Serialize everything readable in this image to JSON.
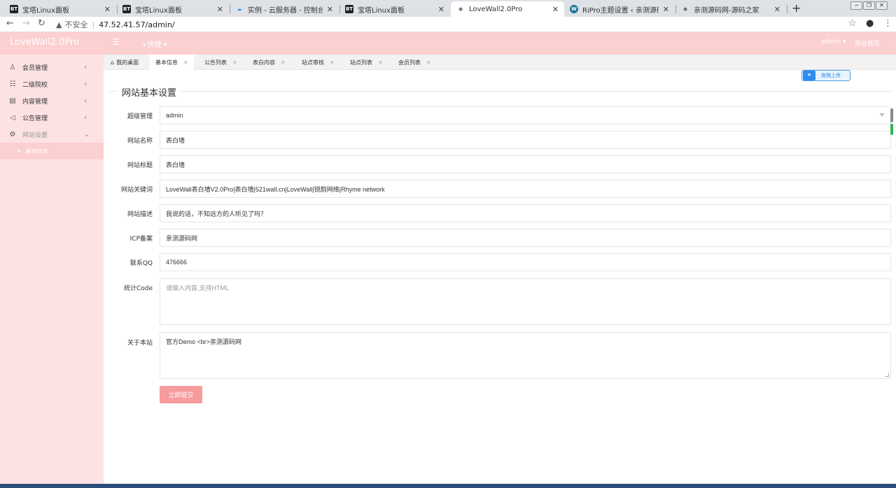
{
  "browser": {
    "tabs": [
      {
        "title": "宝塔Linux面板",
        "icon": "bt-icon"
      },
      {
        "title": "宝塔Linux面板",
        "icon": "bt-icon"
      },
      {
        "title": "实例 - 云服务器 - 控制台",
        "icon": "cloud-icon"
      },
      {
        "title": "宝塔Linux面板",
        "icon": "bt-icon"
      },
      {
        "title": "LoveWall2.0Pro",
        "icon": "globe-icon"
      },
      {
        "title": "RiPro主题设置 ‹ 亲测源码网 — V",
        "icon": "wordpress-icon"
      },
      {
        "title": "亲测源码网-源码之家",
        "icon": "globe-icon"
      }
    ],
    "insecure_label": "不安全",
    "url": "47.52.41.57/admin/"
  },
  "header": {
    "logo": "LoveWall2.0Pro",
    "quick_label": "快捷",
    "user": "admin",
    "front_link": "前台首页"
  },
  "sidebar": {
    "items": [
      {
        "label": "会员管理",
        "icon": "user-icon"
      },
      {
        "label": "二级院校",
        "icon": "list-icon"
      },
      {
        "label": "内容管理",
        "icon": "document-icon"
      },
      {
        "label": "公告管理",
        "icon": "speaker-icon"
      },
      {
        "label": "网站设置",
        "icon": "gear-icon"
      }
    ],
    "sub_item": "基本信息"
  },
  "tabs": [
    {
      "label": "我的桌面"
    },
    {
      "label": "基本信息"
    },
    {
      "label": "公告列表"
    },
    {
      "label": "表白内容"
    },
    {
      "label": "站点审核"
    },
    {
      "label": "站点列表"
    },
    {
      "label": "会员列表"
    }
  ],
  "upload_button": "拖拽上传",
  "form": {
    "title": "网站基本设置",
    "fields": [
      {
        "label": "超级管理",
        "value": "admin"
      },
      {
        "label": "网站名称",
        "value": "表白墙"
      },
      {
        "label": "网站标题",
        "value": "表白墙"
      },
      {
        "label": "网站关键词",
        "value": "LoveWall表白墙V2.0Pro|表白墙|521wall.cn|LoveWall|锐韵网络|Rhyme network"
      },
      {
        "label": "网站描述",
        "value": "我说的话，不知远方的人听见了吗？"
      },
      {
        "label": "ICP备案",
        "value": "亲测源码网"
      },
      {
        "label": "联系QQ",
        "value": "476666"
      },
      {
        "label": "统计Code",
        "value": "",
        "placeholder": "请输入内容,支持HTML"
      },
      {
        "label": "关于本站",
        "value": "官方Demo <br>亲测源码网"
      }
    ],
    "submit": "立即提交"
  },
  "colors": {
    "header_bg": "#fccfd0",
    "sidebar_bg": "#fde2e3",
    "submit_bg": "#f79b9d",
    "upload_blue": "#2d8cf0"
  }
}
